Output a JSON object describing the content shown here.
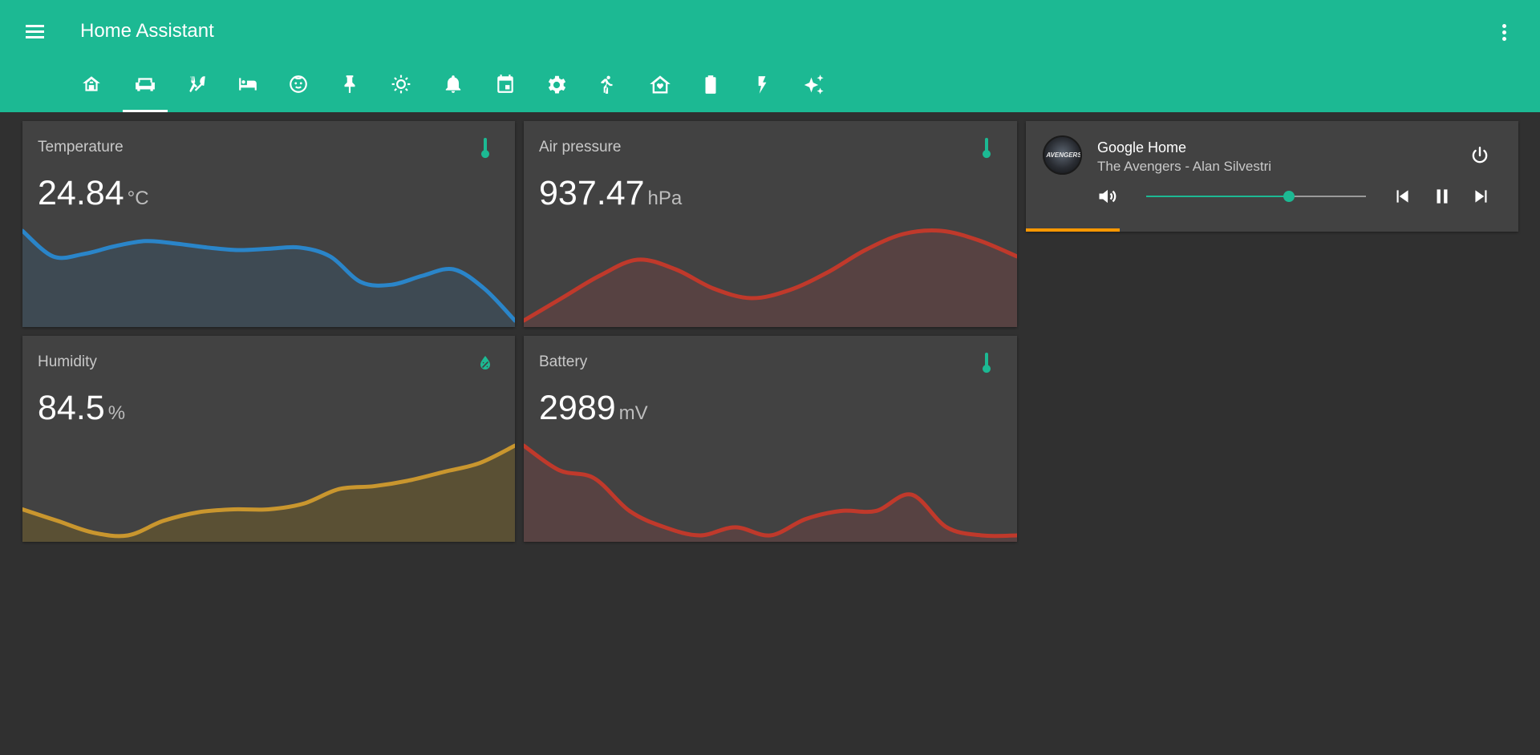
{
  "app": {
    "title": "Home Assistant"
  },
  "colors": {
    "accent": "#1cb993",
    "background": "#303030",
    "card": "#424242",
    "media_progress": "#ff9800"
  },
  "header": {
    "menu_icon": "menu-icon",
    "overflow_icon": "dots-vertical-icon",
    "tabs": [
      {
        "icon": "home-icon",
        "active": false
      },
      {
        "icon": "sofa-icon",
        "active": true
      },
      {
        "icon": "silverware-icon",
        "active": false
      },
      {
        "icon": "bed-icon",
        "active": false
      },
      {
        "icon": "baby-face-icon",
        "active": false
      },
      {
        "icon": "pin-icon",
        "active": false
      },
      {
        "icon": "brightness-icon",
        "active": false
      },
      {
        "icon": "bell-icon",
        "active": false
      },
      {
        "icon": "calendar-icon",
        "active": false
      },
      {
        "icon": "settings-icon",
        "active": false
      },
      {
        "icon": "walk-icon",
        "active": false
      },
      {
        "icon": "home-heart-icon",
        "active": false
      },
      {
        "icon": "battery-icon",
        "active": false
      },
      {
        "icon": "flash-icon",
        "active": false
      },
      {
        "icon": "sparkles-icon",
        "active": false
      }
    ]
  },
  "cards": [
    {
      "name": "Temperature",
      "value": "24.84",
      "unit": "°C",
      "icon": "thermometer-icon",
      "color": "#2a85c9",
      "fill": "#3e4a53",
      "history": [
        24.8,
        24.6,
        24.62,
        24.68,
        24.72,
        24.7,
        24.67,
        24.65,
        24.66,
        24.67,
        24.6,
        24.4,
        24.38,
        24.45,
        24.5,
        24.35,
        24.1
      ]
    },
    {
      "name": "Air pressure",
      "value": "937.47",
      "unit": "hPa",
      "icon": "thermometer-icon",
      "color": "#c0392b",
      "fill": "#574242",
      "history": [
        935.5,
        936.2,
        936.9,
        937.4,
        937.1,
        936.5,
        936.2,
        936.45,
        937.0,
        937.7,
        938.2,
        938.3,
        938.0,
        937.5
      ]
    },
    {
      "name": "Humidity",
      "value": "84.5",
      "unit": "%",
      "icon": "water-percent-icon",
      "color": "#c9962e",
      "fill": "#5a5034",
      "history": [
        82.0,
        81.6,
        81.2,
        81.1,
        81.6,
        81.9,
        82.0,
        82.0,
        82.2,
        82.7,
        82.8,
        83.0,
        83.3,
        83.6,
        84.2
      ]
    },
    {
      "name": "Battery",
      "value": "2989",
      "unit": "mV",
      "icon": "thermometer-icon",
      "color": "#c0392b",
      "fill": "#574242",
      "history": [
        2996,
        2993,
        2992,
        2988,
        2986,
        2985,
        2986,
        2985,
        2987,
        2988,
        2988,
        2990,
        2986,
        2985,
        2985
      ]
    }
  ],
  "media": {
    "name": "Google Home",
    "info": "The Avengers - Alan Silvestri",
    "artwork_text": "AVENGERS",
    "volume_level": 0.65,
    "progress": 0.19,
    "icons": {
      "power": "power-icon",
      "volume": "volume-high-icon",
      "previous": "skip-previous-icon",
      "pause": "pause-icon",
      "next": "skip-next-icon"
    }
  }
}
